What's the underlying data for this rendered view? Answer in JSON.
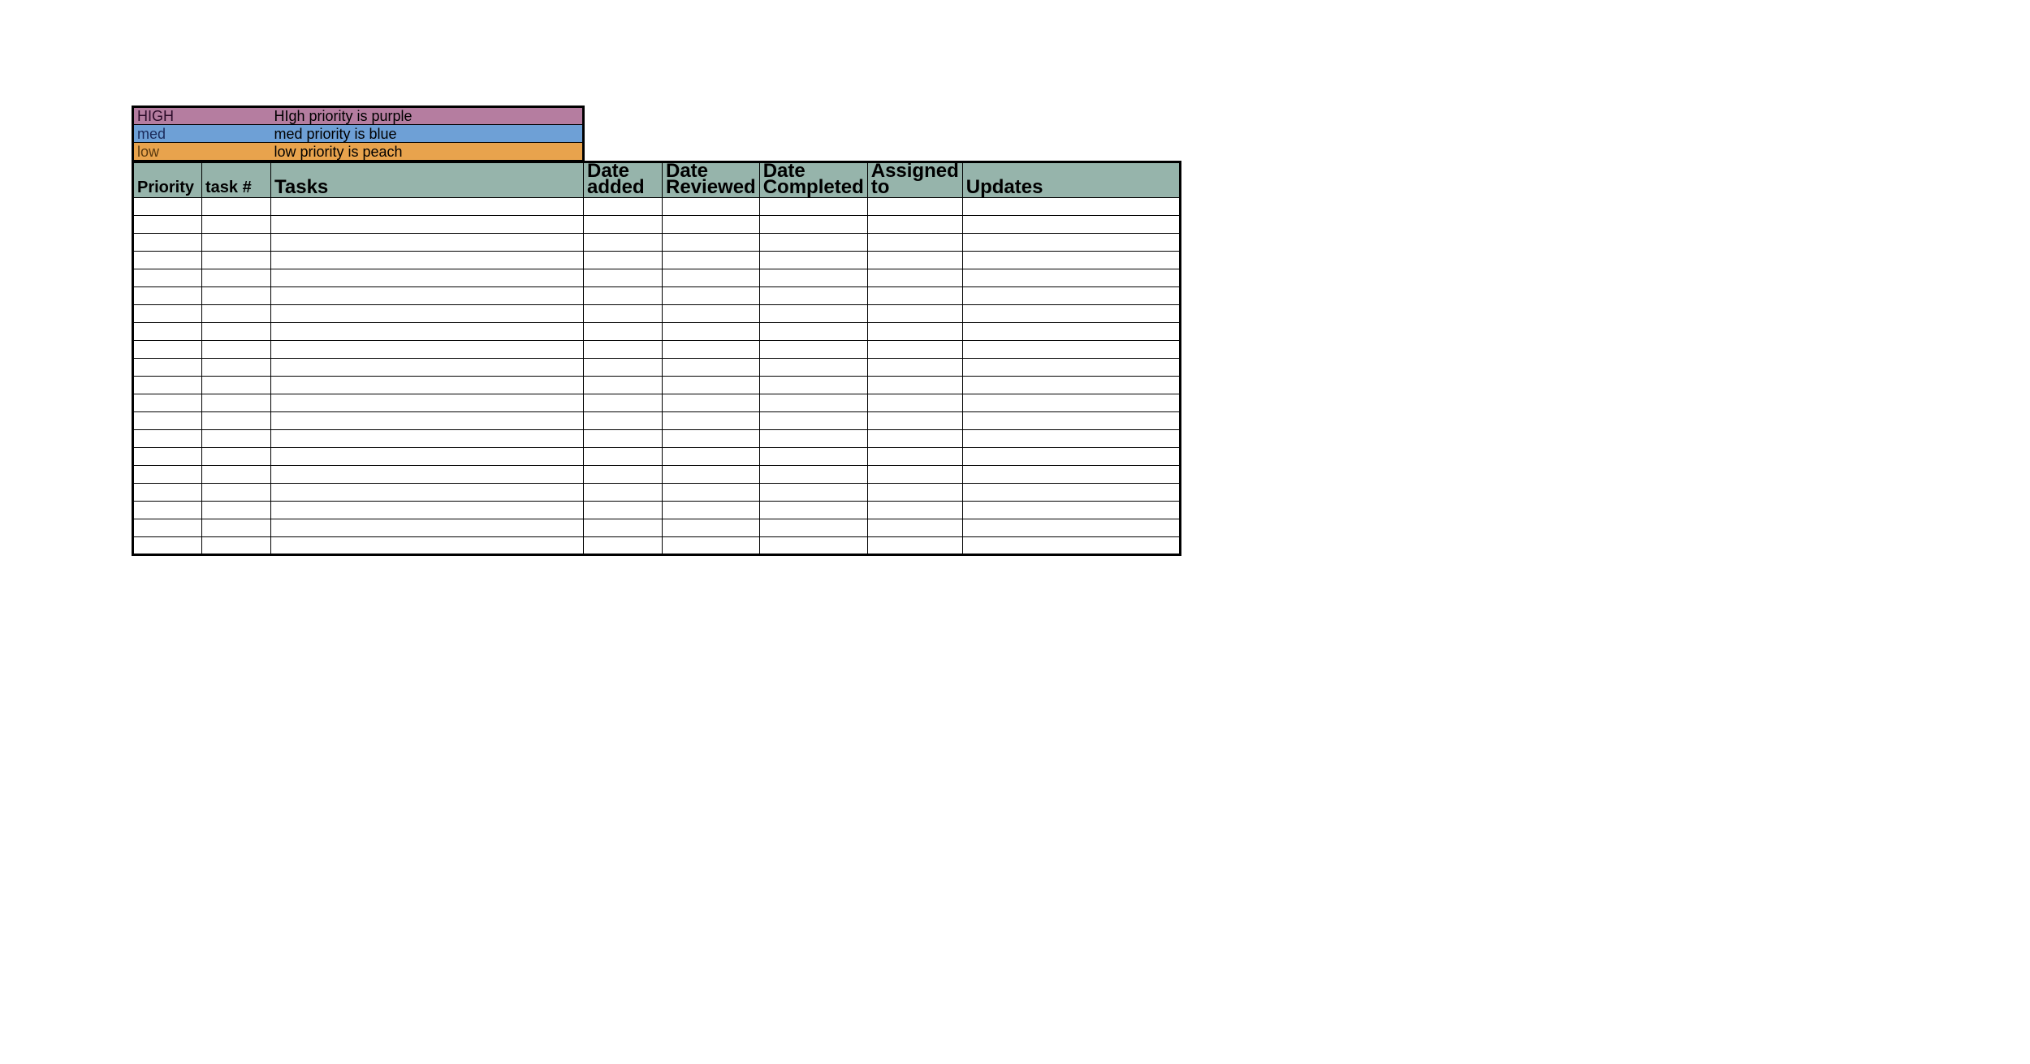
{
  "legend": {
    "high": {
      "label": "HIGH",
      "desc": "HIgh priority is purple"
    },
    "med": {
      "label": "med",
      "desc": "med priority is blue"
    },
    "low": {
      "label": "low",
      "desc": "low priority is peach"
    }
  },
  "columns": {
    "priority": "Priority",
    "tasknum": "task #",
    "tasks": "Tasks",
    "date_added": "Date added",
    "date_reviewed": "Date Reviewed",
    "date_completed": "Date Completed",
    "assigned_to": "Assigned to",
    "updates": "Updates"
  },
  "rows": [
    {
      "priority": "",
      "tasknum": "",
      "tasks": "",
      "date_added": "",
      "date_reviewed": "",
      "date_completed": "",
      "assigned_to": "",
      "updates": ""
    },
    {
      "priority": "",
      "tasknum": "",
      "tasks": "",
      "date_added": "",
      "date_reviewed": "",
      "date_completed": "",
      "assigned_to": "",
      "updates": ""
    },
    {
      "priority": "",
      "tasknum": "",
      "tasks": "",
      "date_added": "",
      "date_reviewed": "",
      "date_completed": "",
      "assigned_to": "",
      "updates": ""
    },
    {
      "priority": "",
      "tasknum": "",
      "tasks": "",
      "date_added": "",
      "date_reviewed": "",
      "date_completed": "",
      "assigned_to": "",
      "updates": ""
    },
    {
      "priority": "",
      "tasknum": "",
      "tasks": "",
      "date_added": "",
      "date_reviewed": "",
      "date_completed": "",
      "assigned_to": "",
      "updates": ""
    },
    {
      "priority": "",
      "tasknum": "",
      "tasks": "",
      "date_added": "",
      "date_reviewed": "",
      "date_completed": "",
      "assigned_to": "",
      "updates": ""
    },
    {
      "priority": "",
      "tasknum": "",
      "tasks": "",
      "date_added": "",
      "date_reviewed": "",
      "date_completed": "",
      "assigned_to": "",
      "updates": ""
    },
    {
      "priority": "",
      "tasknum": "",
      "tasks": "",
      "date_added": "",
      "date_reviewed": "",
      "date_completed": "",
      "assigned_to": "",
      "updates": ""
    },
    {
      "priority": "",
      "tasknum": "",
      "tasks": "",
      "date_added": "",
      "date_reviewed": "",
      "date_completed": "",
      "assigned_to": "",
      "updates": ""
    },
    {
      "priority": "",
      "tasknum": "",
      "tasks": "",
      "date_added": "",
      "date_reviewed": "",
      "date_completed": "",
      "assigned_to": "",
      "updates": ""
    },
    {
      "priority": "",
      "tasknum": "",
      "tasks": "",
      "date_added": "",
      "date_reviewed": "",
      "date_completed": "",
      "assigned_to": "",
      "updates": ""
    },
    {
      "priority": "",
      "tasknum": "",
      "tasks": "",
      "date_added": "",
      "date_reviewed": "",
      "date_completed": "",
      "assigned_to": "",
      "updates": ""
    },
    {
      "priority": "",
      "tasknum": "",
      "tasks": "",
      "date_added": "",
      "date_reviewed": "",
      "date_completed": "",
      "assigned_to": "",
      "updates": ""
    },
    {
      "priority": "",
      "tasknum": "",
      "tasks": "",
      "date_added": "",
      "date_reviewed": "",
      "date_completed": "",
      "assigned_to": "",
      "updates": ""
    },
    {
      "priority": "",
      "tasknum": "",
      "tasks": "",
      "date_added": "",
      "date_reviewed": "",
      "date_completed": "",
      "assigned_to": "",
      "updates": ""
    },
    {
      "priority": "",
      "tasknum": "",
      "tasks": "",
      "date_added": "",
      "date_reviewed": "",
      "date_completed": "",
      "assigned_to": "",
      "updates": ""
    },
    {
      "priority": "",
      "tasknum": "",
      "tasks": "",
      "date_added": "",
      "date_reviewed": "",
      "date_completed": "",
      "assigned_to": "",
      "updates": ""
    },
    {
      "priority": "",
      "tasknum": "",
      "tasks": "",
      "date_added": "",
      "date_reviewed": "",
      "date_completed": "",
      "assigned_to": "",
      "updates": ""
    },
    {
      "priority": "",
      "tasknum": "",
      "tasks": "",
      "date_added": "",
      "date_reviewed": "",
      "date_completed": "",
      "assigned_to": "",
      "updates": ""
    },
    {
      "priority": "",
      "tasknum": "",
      "tasks": "",
      "date_added": "",
      "date_reviewed": "",
      "date_completed": "",
      "assigned_to": "",
      "updates": ""
    }
  ]
}
